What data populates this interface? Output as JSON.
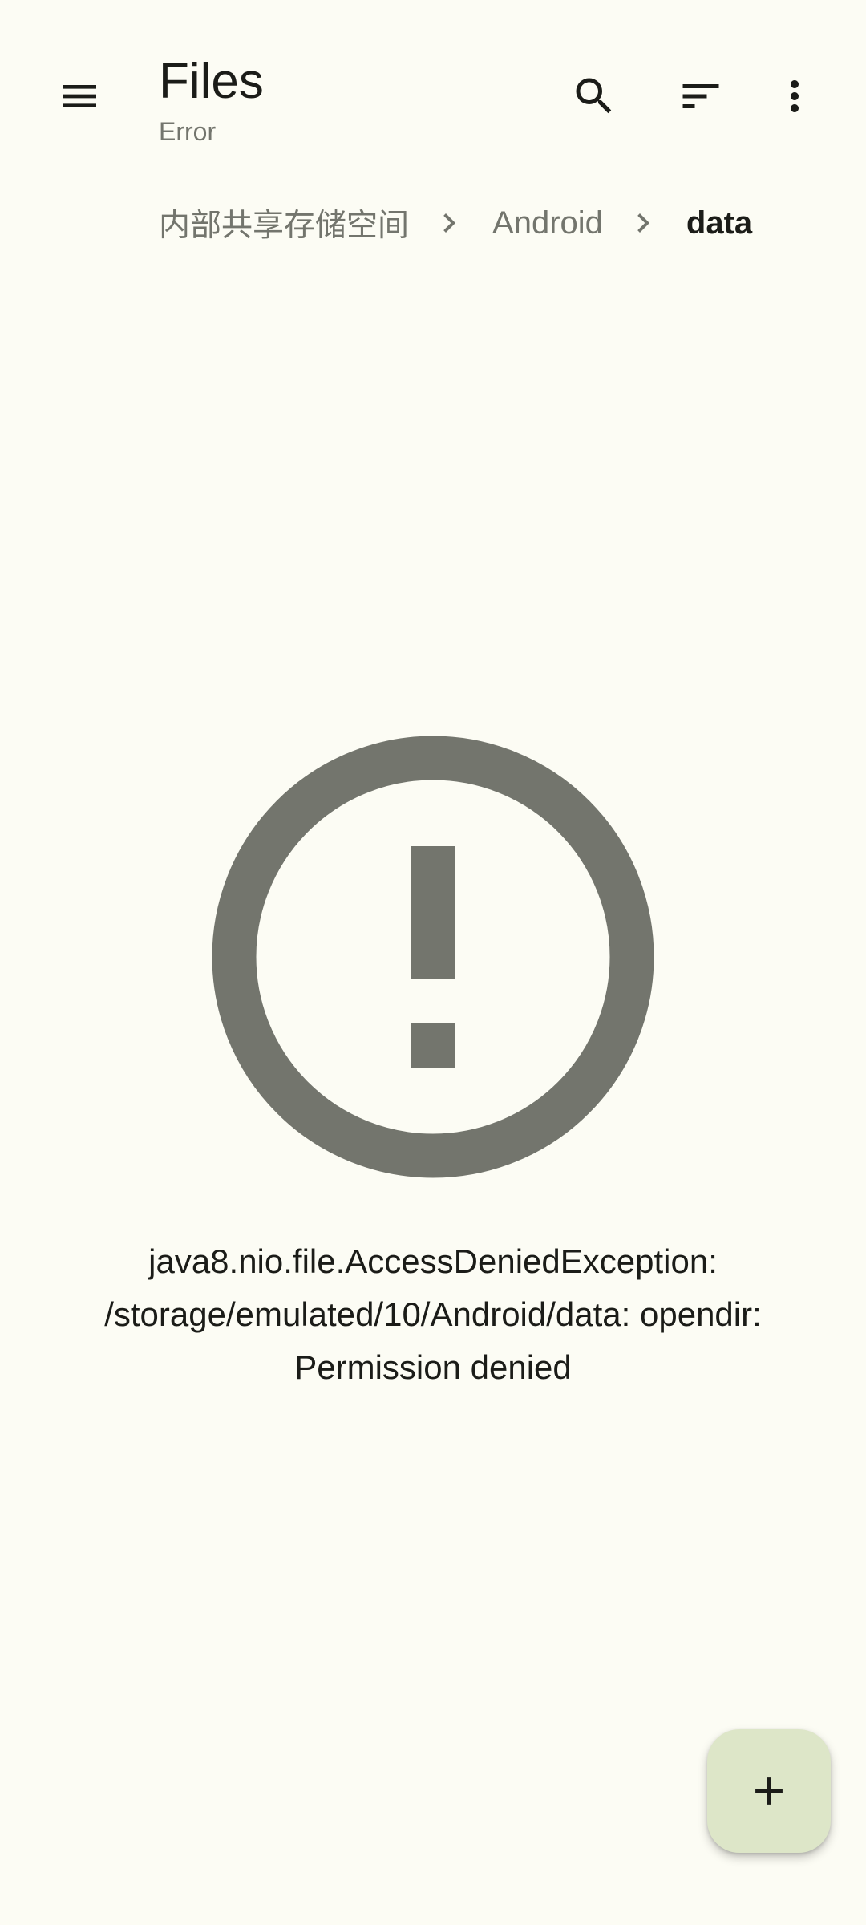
{
  "app_bar": {
    "title": "Files",
    "subtitle": "Error",
    "icons": {
      "menu": "menu-icon",
      "search": "search-icon",
      "sort": "sort-icon",
      "more": "more-vert-icon"
    }
  },
  "breadcrumb": {
    "items": [
      {
        "label": "内部共享存储空间"
      },
      {
        "label": "Android"
      },
      {
        "label": "data"
      }
    ],
    "separator_icon": "chevron-right-icon"
  },
  "error": {
    "icon": "error-outline-icon",
    "message": "java8.nio.file.AccessDeniedException: /storage/emulated/10/Android/data: opendir: Permission denied"
  },
  "fab": {
    "icon": "add-icon"
  },
  "colors": {
    "background": "#FCFCF4",
    "text_primary": "#1B1C18",
    "text_secondary": "#73756D",
    "error_icon": "#73756D",
    "fab_background": "#DDE6C8"
  }
}
